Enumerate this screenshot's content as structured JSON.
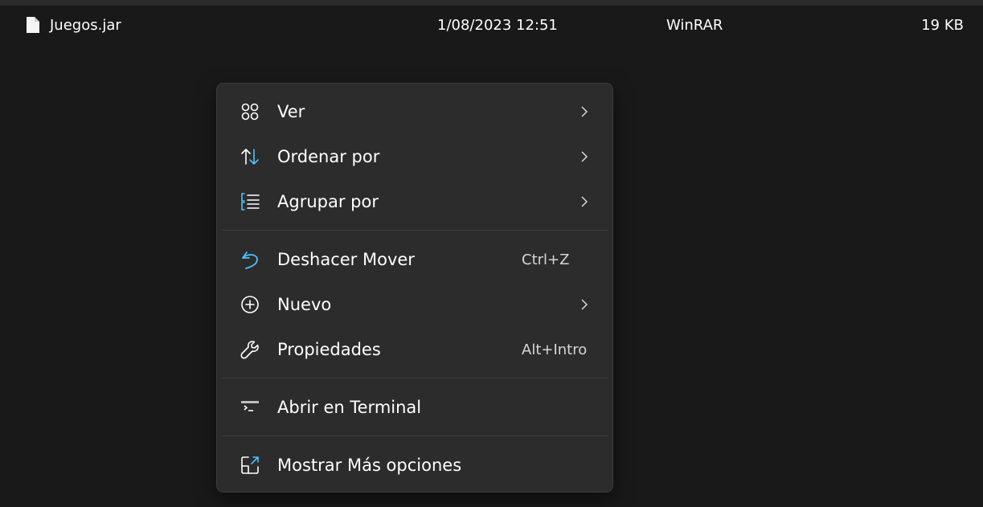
{
  "file": {
    "name": "Juegos.jar",
    "date": "1/08/2023 12:51",
    "type": "WinRAR",
    "size": "19 KB",
    "icon": "document-icon"
  },
  "menu": {
    "items": [
      {
        "label": "Ver",
        "icon": "grid-view-icon",
        "submenu": true
      },
      {
        "label": "Ordenar por",
        "icon": "sort-arrows-icon",
        "submenu": true
      },
      {
        "label": "Agrupar por",
        "icon": "group-list-icon",
        "submenu": true
      },
      {
        "label": "Deshacer Mover",
        "icon": "undo-icon",
        "shortcut": "Ctrl+Z"
      },
      {
        "label": "Nuevo",
        "icon": "add-circle-icon",
        "submenu": true
      },
      {
        "label": "Propiedades",
        "icon": "wrench-icon",
        "shortcut": "Alt+Intro"
      },
      {
        "label": "Abrir en Terminal",
        "icon": "terminal-icon"
      },
      {
        "label": "Mostrar Más opciones",
        "icon": "more-options-icon"
      }
    ]
  },
  "colors": {
    "background": "#191919",
    "menu_background": "#2c2c2c",
    "accent": "#4cc2ff"
  }
}
